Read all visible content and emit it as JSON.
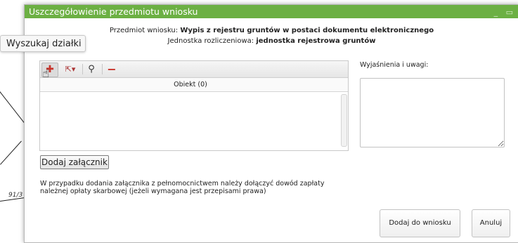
{
  "background": {
    "parcel_label": "91/3"
  },
  "dialog": {
    "title": "Uszczegółowienie przedmiotu wniosku",
    "subject_prefix": "Przedmiot wniosku:",
    "subject_value": "Wypis z rejestru gruntów w postaci dokumentu elektronicznego",
    "unit_prefix": "Jednostka rozliczeniowa:",
    "unit_value": "jednostka rejestrowa gruntów"
  },
  "tooltip": "Wyszukaj działki",
  "grid": {
    "column_header": "Obiekt (0)",
    "toolbar_icons": [
      "add-parcel-icon",
      "select-parcel-icon",
      "search-icon",
      "remove-icon"
    ]
  },
  "notes": {
    "label": "Wyjaśnienia i uwagi:",
    "value": ""
  },
  "attach_button": "Dodaj załącznik",
  "info_text": "W przypadku dodania załącznika z pełnomocnictwem należy dołączyć dowód zapłaty należnej opłaty skarbowej (jeżeli wymagana jest przepisami prawa)",
  "buttons": {
    "add_to_request": "Dodaj do wniosku",
    "cancel": "Anuluj"
  },
  "colors": {
    "titlebar": "#6cb043",
    "danger_icon": "#c8332a"
  }
}
